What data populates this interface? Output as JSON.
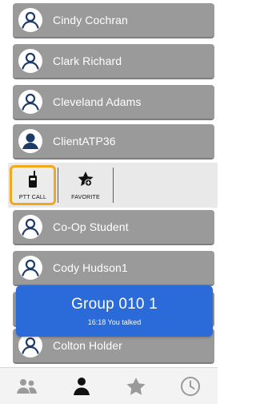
{
  "contacts": [
    {
      "name": "Cindy Cochran",
      "icon": "user-outline-icon"
    },
    {
      "name": "Clark Richard",
      "icon": "user-outline-icon"
    },
    {
      "name": "Cleveland Adams",
      "icon": "user-outline-icon"
    },
    {
      "name": "ClientATP36",
      "icon": "user-filled-icon"
    },
    {
      "name": "Co-Op Student",
      "icon": "user-outline-icon"
    },
    {
      "name": "Cody Hudson1",
      "icon": "user-outline-icon"
    },
    {
      "name": "Colton Holder",
      "icon": "user-outline-icon"
    }
  ],
  "actions": {
    "ptt_label": "PTT CALL",
    "favorite_label": "FAVORITE"
  },
  "toast": {
    "title": "Group 010 1",
    "subtitle": "16:18 You talked"
  },
  "tabs": [
    {
      "icon": "groups-icon",
      "active": false
    },
    {
      "icon": "contacts-icon",
      "active": true
    },
    {
      "icon": "favorites-icon",
      "active": false
    },
    {
      "icon": "history-icon",
      "active": false
    }
  ],
  "colors": {
    "row_bg": "#9a9a9a",
    "highlight": "#f3a81c",
    "toast_bg": "#2a6ad9",
    "tab_active": "#111111",
    "tab_inactive": "#9a9a9a"
  }
}
